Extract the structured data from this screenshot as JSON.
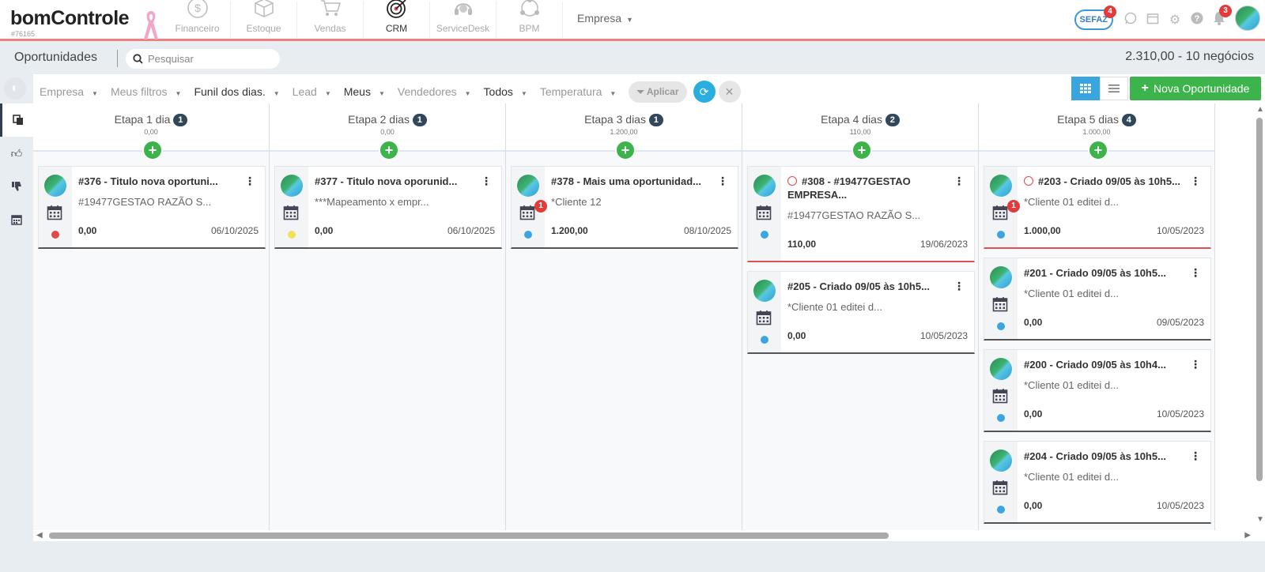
{
  "topbar": {
    "logo_text": "bomControle",
    "account_id": "#76165",
    "modules": [
      {
        "label": "Financeiro",
        "icon": "dollar-circle-icon",
        "active": false
      },
      {
        "label": "Estoque",
        "icon": "box-icon",
        "active": false
      },
      {
        "label": "Vendas",
        "icon": "cart-icon",
        "active": false
      },
      {
        "label": "CRM",
        "icon": "target-icon",
        "active": true
      },
      {
        "label": "ServiceDesk",
        "icon": "headset-icon",
        "active": false
      },
      {
        "label": "BPM",
        "icon": "network-icon",
        "active": false
      }
    ],
    "company_menu": "Empresa",
    "sefaz_label": "SEFAZ",
    "sefaz_badge": "4",
    "notifications_badge": "3"
  },
  "pagebar": {
    "title": "Oportunidades",
    "search_placeholder": "Pesquisar",
    "totals": "2.310,00 - 10 negócios"
  },
  "filters": [
    {
      "label": "Empresa",
      "style": "muted"
    },
    {
      "label": "Meus filtros",
      "style": "muted"
    },
    {
      "label": "Funil dos dias.",
      "style": "dark"
    },
    {
      "label": "Lead",
      "style": "muted"
    },
    {
      "label": "Meus",
      "style": "dark"
    },
    {
      "label": "Vendedores",
      "style": "muted"
    },
    {
      "label": "Todos",
      "style": "dark"
    },
    {
      "label": "Temperatura",
      "style": "muted"
    }
  ],
  "actions": {
    "apply_label": "Aplicar",
    "new_opportunity_label": "Nova Oportunidade"
  },
  "columns": [
    {
      "title": "Etapa 1 dia",
      "count": "1",
      "value": "0,00",
      "cards": [
        {
          "title": "#376 - Titulo nova oportuni...",
          "subtitle": "#19477GESTAO RAZÃO S...",
          "value": "0,00",
          "date": "06/10/2025",
          "dot_color": "#e04a4a",
          "overdue": false,
          "cal_badge": "",
          "underline": "dark"
        }
      ]
    },
    {
      "title": "Etapa 2 dias",
      "count": "1",
      "value": "0,00",
      "cards": [
        {
          "title": "#377 - Titulo nova oporunid...",
          "subtitle": "***Mapeamento x empr...",
          "value": "0,00",
          "date": "06/10/2025",
          "dot_color": "#f1e05a",
          "overdue": false,
          "cal_badge": "",
          "underline": "dark"
        }
      ]
    },
    {
      "title": "Etapa 3 dias",
      "count": "1",
      "value": "1.200,00",
      "cards": [
        {
          "title": "#378 - Mais uma oportunidad...",
          "subtitle": "*Cliente 12",
          "value": "1.200,00",
          "date": "08/10/2025",
          "dot_color": "#3aa6e0",
          "overdue": false,
          "cal_badge": "1",
          "underline": "dark"
        }
      ]
    },
    {
      "title": "Etapa 4 dias",
      "count": "2",
      "value": "110,00",
      "cards": [
        {
          "title": "#308 - #19477GESTAO EMPRESA...",
          "subtitle": "#19477GESTAO RAZÃO S...",
          "value": "110,00",
          "date": "19/06/2023",
          "dot_color": "#3aa6e0",
          "overdue": true,
          "cal_badge": "",
          "underline": "red"
        },
        {
          "title": "#205 - Criado 09/05 às 10h5...",
          "subtitle": "*Cliente 01 editei d...",
          "value": "0,00",
          "date": "10/05/2023",
          "dot_color": "#3aa6e0",
          "overdue": false,
          "cal_badge": "",
          "underline": "dark"
        }
      ]
    },
    {
      "title": "Etapa 5 dias",
      "count": "4",
      "value": "1.000,00",
      "cards": [
        {
          "title": "#203 - Criado 09/05 às 10h5...",
          "subtitle": "*Cliente 01 editei d...",
          "value": "1.000,00",
          "date": "10/05/2023",
          "dot_color": "#3aa6e0",
          "overdue": true,
          "cal_badge": "1",
          "underline": "red"
        },
        {
          "title": "#201 - Criado 09/05 às 10h5...",
          "subtitle": "*Cliente 01 editei d...",
          "value": "0,00",
          "date": "09/05/2023",
          "dot_color": "#3aa6e0",
          "overdue": false,
          "cal_badge": "",
          "underline": "dark"
        },
        {
          "title": "#200 - Criado 09/05 às 10h4...",
          "subtitle": "*Cliente 01 editei d...",
          "value": "0,00",
          "date": "10/05/2023",
          "dot_color": "#3aa6e0",
          "overdue": false,
          "cal_badge": "",
          "underline": "dark"
        },
        {
          "title": "#204 - Criado 09/05 às 10h5...",
          "subtitle": "*Cliente 01 editei d...",
          "value": "0,00",
          "date": "10/05/2023",
          "dot_color": "#3aa6e0",
          "overdue": false,
          "cal_badge": "",
          "underline": "dark"
        }
      ]
    }
  ],
  "colors": {
    "accent_blue": "#3aa6e0",
    "accent_green": "#3cb44b",
    "topbar_border": "#f08080",
    "badge_red": "#e23b3b"
  }
}
